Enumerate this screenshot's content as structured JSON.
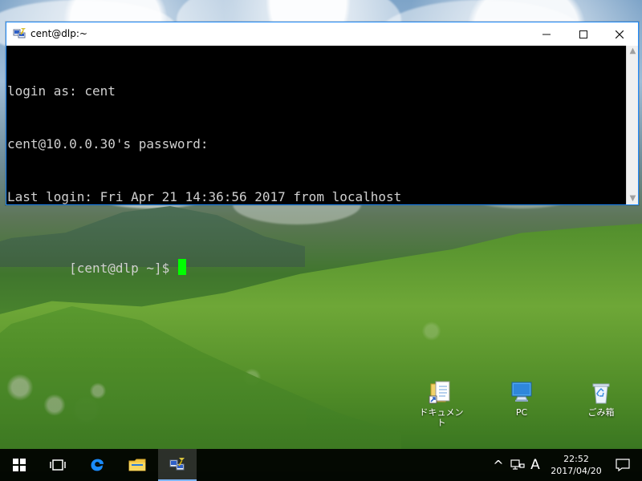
{
  "window": {
    "title": "cent@dlp:~",
    "controls": {
      "minimize_icon": "minimize-icon",
      "maximize_icon": "maximize-icon",
      "close_icon": "close-icon"
    }
  },
  "terminal": {
    "lines": [
      "login as: cent",
      "cent@10.0.0.30's password:",
      "Last login: Fri Apr 21 14:36:56 2017 from localhost",
      "[cent@dlp ~]$"
    ],
    "cursor_color": "#00FF00",
    "background_color": "#000000",
    "text_color": "#D0D0D0"
  },
  "desktop": {
    "icons": [
      {
        "label": "ドキュメント",
        "icon": "documents-icon"
      },
      {
        "label": "PC",
        "icon": "computer-icon"
      },
      {
        "label": "ごみ箱",
        "icon": "recycle-bin-icon"
      }
    ]
  },
  "taskbar": {
    "apps": [
      {
        "icon": "windows-start-icon"
      },
      {
        "icon": "task-view-icon"
      },
      {
        "icon": "edge-icon"
      },
      {
        "icon": "file-explorer-icon"
      },
      {
        "icon": "putty-icon"
      }
    ],
    "tray": {
      "chevron": "^",
      "network_icon": "network-icon",
      "ime_label": "A",
      "time": "22:52",
      "date": "2017/04/20",
      "notification_icon": "notification-icon"
    }
  },
  "colors": {
    "window_border": "#1F8CFF",
    "taskbar": "#000000",
    "putty_highlight": "#7FB7FF"
  }
}
